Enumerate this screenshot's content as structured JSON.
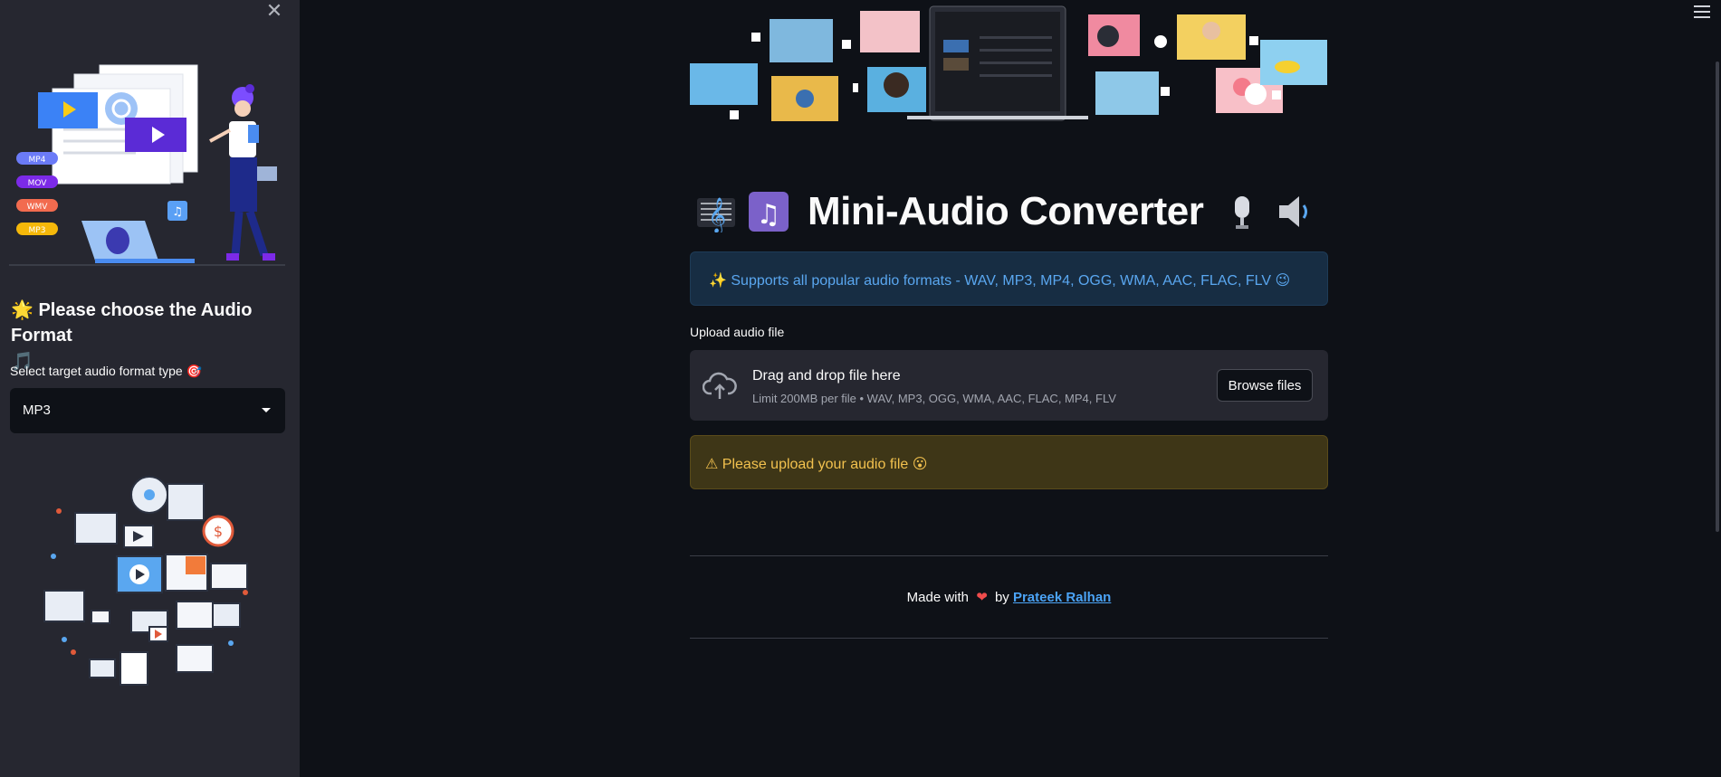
{
  "sidebar": {
    "close_symbol": "✕",
    "heading_emoji": "🌟",
    "heading": "Please choose the Audio Format",
    "heading_emoji_after": "🎵",
    "select_label": "Select target audio format type",
    "select_label_emoji": "🎯",
    "selected_value": "MP3",
    "format_badges": [
      "MP4",
      "MOV",
      "WMV",
      "MP3"
    ]
  },
  "main": {
    "title": "Mini-Audio Converter",
    "title_icons": [
      "music-score-icon",
      "music-notes-icon",
      "microphone-icon",
      "speaker-icon"
    ],
    "info_prefix_emoji": "✨",
    "info_text": "Supports all popular audio formats - WAV, MP3, MP4, OGG, WMA, AAC, FLAC, FLV",
    "info_suffix_emoji": "😉",
    "upload_label": "Upload audio file",
    "dropzone_title": "Drag and drop file here",
    "dropzone_hint": "Limit 200MB per file • WAV, MP3, OGG, WMA, AAC, FLAC, MP4, FLV",
    "browse_label": "Browse files",
    "warning_prefix": "⚠",
    "warning_text": "Please upload your audio file",
    "warning_suffix_emoji": "😮",
    "footer_made_with": "Made with",
    "footer_by": "by",
    "footer_author": "Prateek Ralhan"
  },
  "colors": {
    "background": "#0e1117",
    "sidebar": "#262730",
    "info_text": "#5aa7f0",
    "warning_text": "#f2c14e",
    "link": "#4ba3f5"
  }
}
